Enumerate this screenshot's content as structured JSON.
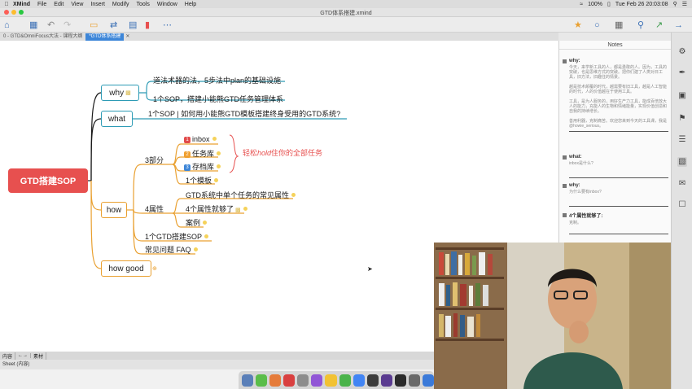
{
  "menubar": {
    "items": [
      "XMind",
      "File",
      "Edit",
      "View",
      "Insert",
      "Modify",
      "Tools",
      "Window",
      "Help"
    ],
    "battery": "100%",
    "clock": "Tue Feb 26  20:03:08"
  },
  "window": {
    "title": "GTD体系搭建.xmind"
  },
  "tabs": [
    {
      "label": "0 - GTD&OmniFocus大法 - 课程大纲"
    },
    {
      "label": "*GTD体系搭建"
    }
  ],
  "mindmap": {
    "root": "GTD搭建SOP",
    "why": {
      "label": "why",
      "children": [
        "道法术器的法，5步法中plan的基础设施",
        "1个SOP，搭建小能熊GTD任务管理体系"
      ]
    },
    "what": {
      "label": "what",
      "children": [
        "1个SOP | 如何用小能熊GTD模板搭建终身受用的GTD系统?"
      ]
    },
    "how": {
      "label": "how",
      "parts": {
        "label": "3部分",
        "items": [
          {
            "num": "1",
            "label": "inbox",
            "color": "#e14a4a"
          },
          {
            "num": "2",
            "label": "任务库",
            "color": "#f0a030"
          },
          {
            "num": "3",
            "label": "存档库",
            "color": "#3d86d8"
          },
          {
            "num": "",
            "label": "1个模板",
            "color": ""
          }
        ],
        "callout": "轻松",
        "callout_em": "hold",
        "callout_tail": "住你的全部任务"
      },
      "attrs": {
        "label": "4属性",
        "items": [
          "GTD系统中单个任务的常见属性",
          "4个属性就够了",
          "案例"
        ]
      },
      "sop": "1个GTD搭建SOP",
      "faq": "常见问题 FAQ"
    },
    "howgood": {
      "label": "how good"
    }
  },
  "notes": {
    "title": "Notes",
    "sections": [
      {
        "head": "why:",
        "body": "今天，来学新工具的人，都是勇敢的人。因为，工具的突破，也是思维方式的突破。把你们建了人类对日工具，旧方法，旧趣往的情景。\n\n越是技术颠覆的时代，越需要有旧工具，越是人工智能的时代，人的价值越在于使用工具。\n\n工具，是为人服务的，用好生产力工具，能成百倍放大人的能力，充能人的生物和情绪能量，实现价值创造和自我的持续增长。\n\n善用利器，克制痛苦。欢迎您来到今天的工具课，我是@howie_serious。"
      },
      {
        "head": "what:",
        "body": "inbox是什么?"
      },
      {
        "head": "why:",
        "body": "为什么要有inbox?"
      },
      {
        "head": "4个属性就够了:",
        "body": "克制。"
      }
    ]
  },
  "sheet_tabs": [
    "内容",
    "素材"
  ],
  "status": "Sheet (内容)",
  "colors": {
    "root": "#e7504f",
    "teal": "#2d9bb5",
    "branch": "#e9a030",
    "tab_active": "#3d86d8"
  }
}
